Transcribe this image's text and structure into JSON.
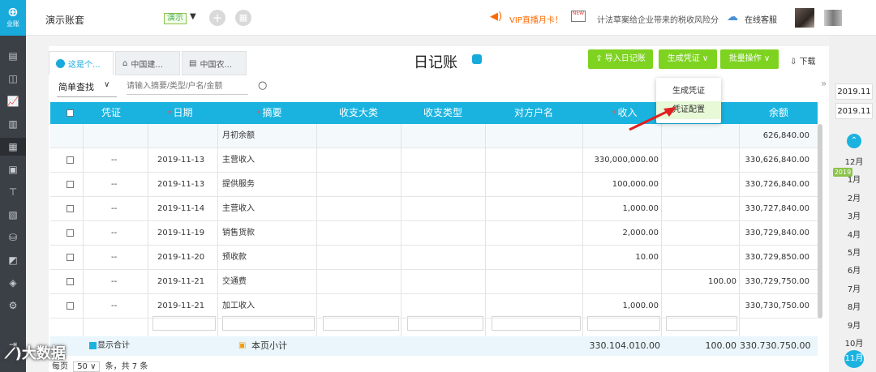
{
  "app": {
    "logo_text": "业账"
  },
  "topbar": {
    "account_name": "演示账套",
    "account_badge": "演示",
    "vip_text": "VIP直播月卡！",
    "news_text": "计法草案给企业带来的税收风险分",
    "service_text": "在线客服"
  },
  "tabs": [
    {
      "label": "这是个..."
    },
    {
      "label": "中国建..."
    },
    {
      "label": "中国农..."
    }
  ],
  "page": {
    "title": "日记账"
  },
  "toolbar": {
    "import_label": "导入日记账",
    "generate_label": "生成凭证",
    "batch_label": "批量操作",
    "download_label": "下载"
  },
  "search": {
    "mode_label": "简单查找",
    "placeholder": "请输入摘要/类型/户名/金额"
  },
  "dropdown": {
    "items": [
      "生成凭证",
      "凭证配置"
    ]
  },
  "table": {
    "headers": {
      "voucher": "凭证",
      "date": "日期",
      "summary": "摘要",
      "income_major": "收支大类",
      "income_type": "收支类型",
      "counterparty": "对方户名",
      "income": "收入",
      "balance": "余额"
    },
    "opening": {
      "summary": "月初余额",
      "balance": "626,840.00"
    },
    "rows": [
      {
        "voucher": "--",
        "date": "2019-11-13",
        "summary": "主营收入",
        "income": "330,000,000.00",
        "expense": "",
        "balance": "330,626,840.00"
      },
      {
        "voucher": "--",
        "date": "2019-11-13",
        "summary": "提供服务",
        "income": "100,000.00",
        "expense": "",
        "balance": "330,726,840.00"
      },
      {
        "voucher": "--",
        "date": "2019-11-14",
        "summary": "主营收入",
        "income": "1,000.00",
        "expense": "",
        "balance": "330,727,840.00"
      },
      {
        "voucher": "--",
        "date": "2019-11-19",
        "summary": "销售货款",
        "income": "2,000.00",
        "expense": "",
        "balance": "330,729,840.00"
      },
      {
        "voucher": "--",
        "date": "2019-11-20",
        "summary": "预收款",
        "income": "10.00",
        "expense": "",
        "balance": "330,729,850.00"
      },
      {
        "voucher": "--",
        "date": "2019-11-21",
        "summary": "交通费",
        "income": "",
        "expense": "100.00",
        "balance": "330,729,750.00"
      },
      {
        "voucher": "--",
        "date": "2019-11-21",
        "summary": "加工收入",
        "income": "1,000.00",
        "expense": "",
        "balance": "330,730,750.00"
      }
    ],
    "footer": {
      "show_total": "显示合计",
      "subtotal_label": "本页小计",
      "income_total": "330.104.010.00",
      "expense_total": "100.00",
      "balance_total": "330.730.750.00"
    },
    "pager": {
      "per_page_label": "每页",
      "per_page": "50",
      "summary": "条，共 7 条"
    }
  },
  "periods": {
    "from": "2019.11",
    "to": "2019.11",
    "year_badge": "2019",
    "months": [
      "12月",
      "1月",
      "2月",
      "3月",
      "4月",
      "5月",
      "6月",
      "7月",
      "8月",
      "9月",
      "10月"
    ],
    "active_month": "11月"
  },
  "watermark": "大数据"
}
